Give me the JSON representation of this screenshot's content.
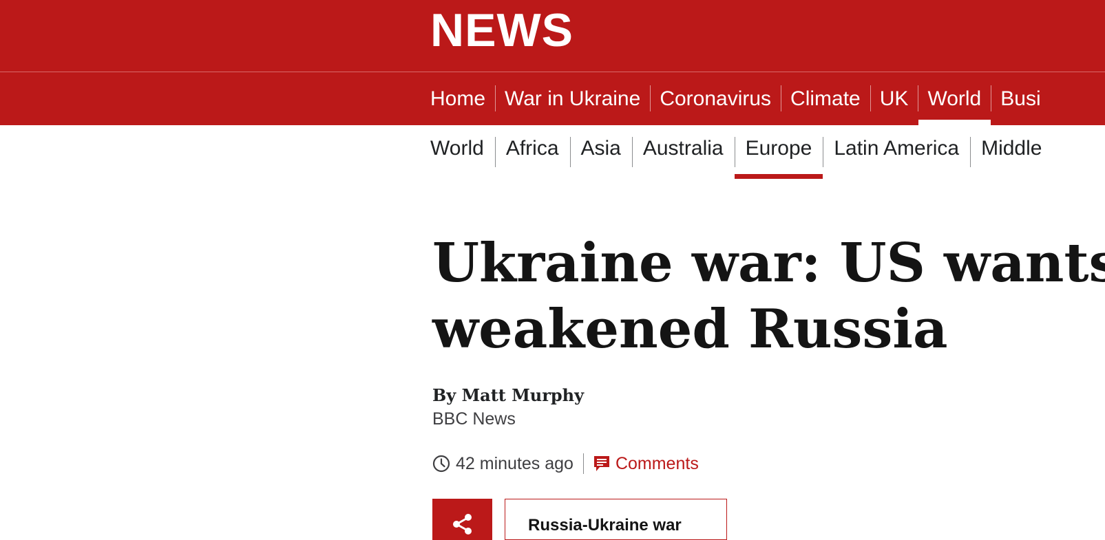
{
  "masthead": {
    "logo_text": "NEWS"
  },
  "main_nav": {
    "items": [
      {
        "label": "Home"
      },
      {
        "label": "War in Ukraine"
      },
      {
        "label": "Coronavirus"
      },
      {
        "label": "Climate"
      },
      {
        "label": "UK"
      },
      {
        "label": "World",
        "active": true
      },
      {
        "label": "Busi"
      }
    ]
  },
  "sub_nav": {
    "items": [
      {
        "label": "World"
      },
      {
        "label": "Africa"
      },
      {
        "label": "Asia"
      },
      {
        "label": "Australia"
      },
      {
        "label": "Europe",
        "active": true
      },
      {
        "label": "Latin America"
      },
      {
        "label": "Middle"
      }
    ]
  },
  "article": {
    "headline_line1": "Ukraine war: US wants",
    "headline_line2": "weakened Russia",
    "byline_name": "By Matt Murphy",
    "byline_org": "BBC News",
    "timestamp": "42 minutes ago",
    "comments_label": "Comments",
    "topic_tag": "Russia-Ukraine war"
  },
  "colors": {
    "brand": "#bb1919",
    "text": "#141414"
  },
  "icons": {
    "clock": "clock-icon",
    "comments": "comment-icon",
    "share": "share-icon"
  }
}
